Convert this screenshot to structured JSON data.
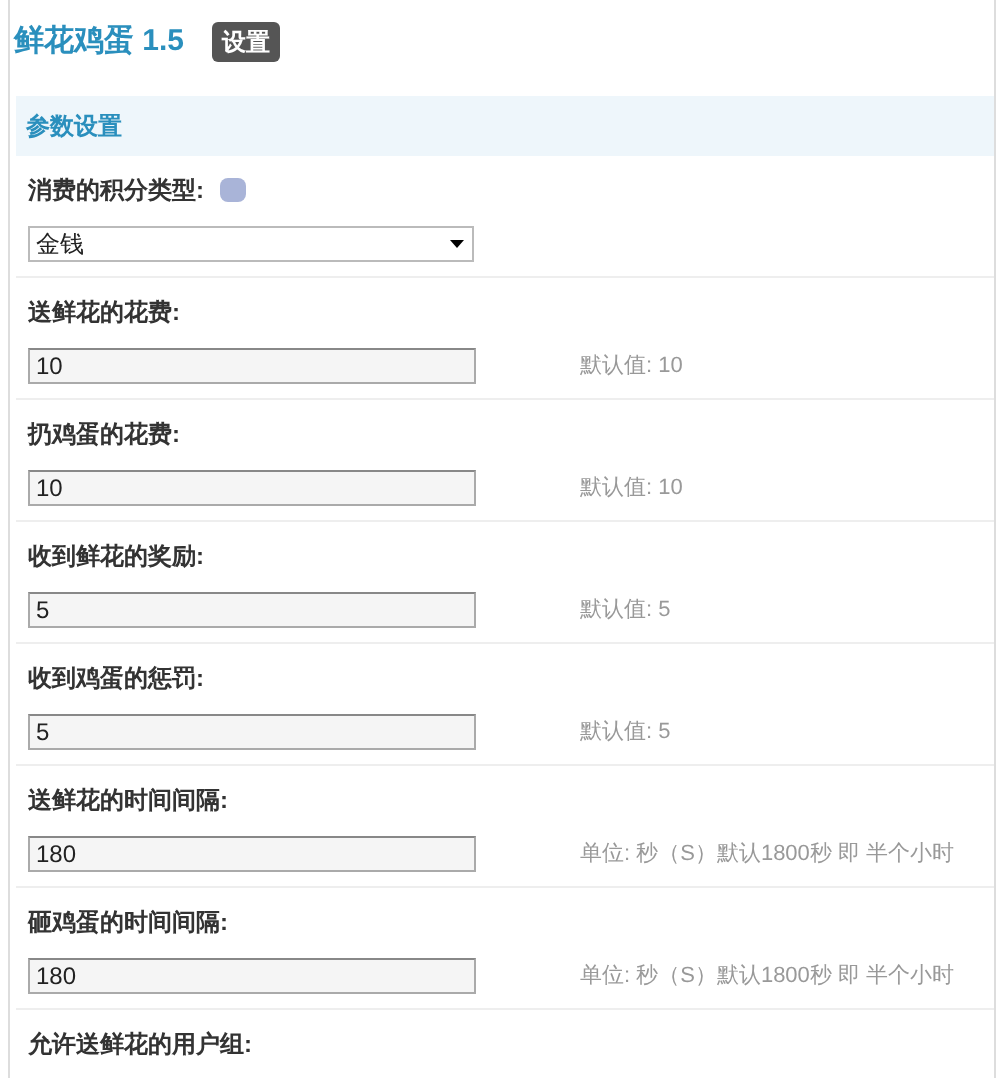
{
  "title": "鲜花鸡蛋 1.5",
  "title_tag": "设置",
  "section": "参数设置",
  "fields": [
    {
      "kind": "select",
      "label": "消费的积分类型:",
      "help": true,
      "value": "金钱"
    },
    {
      "kind": "text",
      "label": "送鲜花的花费:",
      "value": "10",
      "hint": "默认值: 10"
    },
    {
      "kind": "text",
      "label": "扔鸡蛋的花费:",
      "value": "10",
      "hint": "默认值: 10"
    },
    {
      "kind": "text",
      "label": "收到鲜花的奖励:",
      "value": "5",
      "hint": "默认值: 5"
    },
    {
      "kind": "text",
      "label": "收到鸡蛋的惩罚:",
      "value": "5",
      "hint": "默认值: 5"
    },
    {
      "kind": "text",
      "label": "送鲜花的时间间隔:",
      "value": "180",
      "hint": "单位: 秒（S）默认1800秒 即 半个小时"
    },
    {
      "kind": "text",
      "label": "砸鸡蛋的时间间隔:",
      "value": "180",
      "hint": "单位: 秒（S）默认1800秒 即 半个小时"
    },
    {
      "kind": "label",
      "label": "允许送鲜花的用户组:"
    }
  ]
}
